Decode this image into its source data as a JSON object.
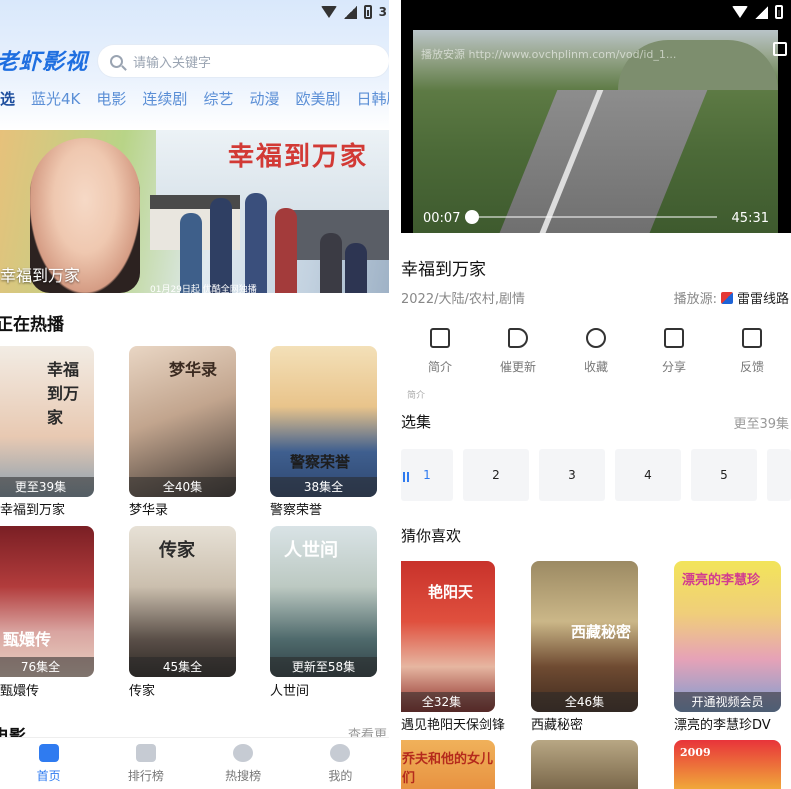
{
  "left": {
    "status": {
      "battery_text": "3"
    },
    "logo": "老虾影视",
    "search": {
      "placeholder": "请输入关键字"
    },
    "tabs": [
      "选",
      "蓝光4K",
      "电影",
      "连续剧",
      "综艺",
      "动漫",
      "欧美剧",
      "日韩剧"
    ],
    "banner": {
      "artwork_title": "幸福到万家",
      "caption": "幸福到万家",
      "date": "01月29日起 优酷全网独播"
    },
    "hot": {
      "title": "正在热播",
      "items": [
        {
          "name": "幸福到万家",
          "badge": "更至39集",
          "art": "幸福到万家"
        },
        {
          "name": "梦华录",
          "badge": "全40集",
          "art": "梦华录"
        },
        {
          "name": "警察荣誉",
          "badge": "38集全",
          "art": "警察荣誉"
        },
        {
          "name": "甄嬛传",
          "badge": "76集全",
          "art": "甄嬛传"
        },
        {
          "name": "传家",
          "badge": "45集全",
          "art": "传家"
        },
        {
          "name": "人世间",
          "badge": "更新至58集",
          "art": "人世间"
        }
      ]
    },
    "movies": {
      "title": "电影",
      "more": "查看更"
    },
    "nav": [
      {
        "label": "首页",
        "icon": "home-icon"
      },
      {
        "label": "排行榜",
        "icon": "crown-icon"
      },
      {
        "label": "热搜榜",
        "icon": "compass-icon"
      },
      {
        "label": "我的",
        "icon": "user-icon"
      }
    ]
  },
  "right": {
    "video": {
      "url": "播放安源 http://www.ovchplinm.com/vod/id_1...",
      "current": "00:07",
      "duration": "45:31",
      "progress": 0.0026
    },
    "detail": {
      "title": "幸福到万家",
      "meta": "2022/大陆/农村,剧情",
      "source_label": "播放源:",
      "source_name": "雷雷线路"
    },
    "actions": [
      {
        "label": "简介",
        "icon": "document-icon"
      },
      {
        "label": "催更新",
        "icon": "megaphone-icon"
      },
      {
        "label": "收藏",
        "icon": "star-icon"
      },
      {
        "label": "分享",
        "icon": "share-icon"
      },
      {
        "label": "反馈",
        "icon": "edit-icon"
      }
    ],
    "tiny_text": "简介",
    "episodes": {
      "title": "选集",
      "more": "更至39集",
      "list": [
        "1",
        "2",
        "3",
        "4",
        "5"
      ]
    },
    "recommend": {
      "title": "猜你喜欢",
      "items": [
        {
          "name": "遇见艳阳天保剑锋",
          "badge": "全32集",
          "art": "艳阳天"
        },
        {
          "name": "西藏秘密",
          "badge": "全46集",
          "art": "西藏秘密"
        },
        {
          "name": "漂亮的李慧珍DV",
          "badge": "开通视频会员",
          "art": "漂亮的李慧珍"
        },
        {
          "name": "",
          "badge": "",
          "art": "乔夫和他的女儿们"
        },
        {
          "name": "",
          "badge": "",
          "art": ""
        },
        {
          "name": "",
          "badge": "",
          "art": "2009"
        }
      ]
    }
  }
}
